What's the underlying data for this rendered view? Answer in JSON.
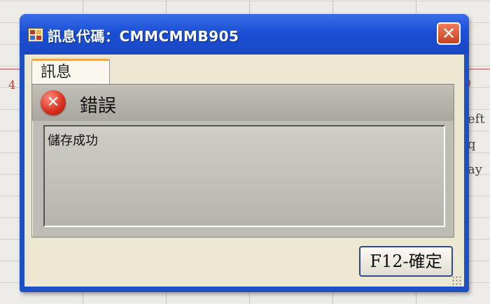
{
  "window": {
    "title": "訊息代碼：CMMCMMB905",
    "close_symbol": "✕"
  },
  "tab": {
    "label": "訊息"
  },
  "message": {
    "severity": "錯誤",
    "icon_symbol": "✕",
    "text": "儲存成功"
  },
  "buttons": {
    "ok_label": "F12-確定"
  },
  "background": {
    "row_number_left": "4",
    "row_number_right": "0",
    "fragments": [
      "eft",
      "q",
      "ay"
    ]
  }
}
